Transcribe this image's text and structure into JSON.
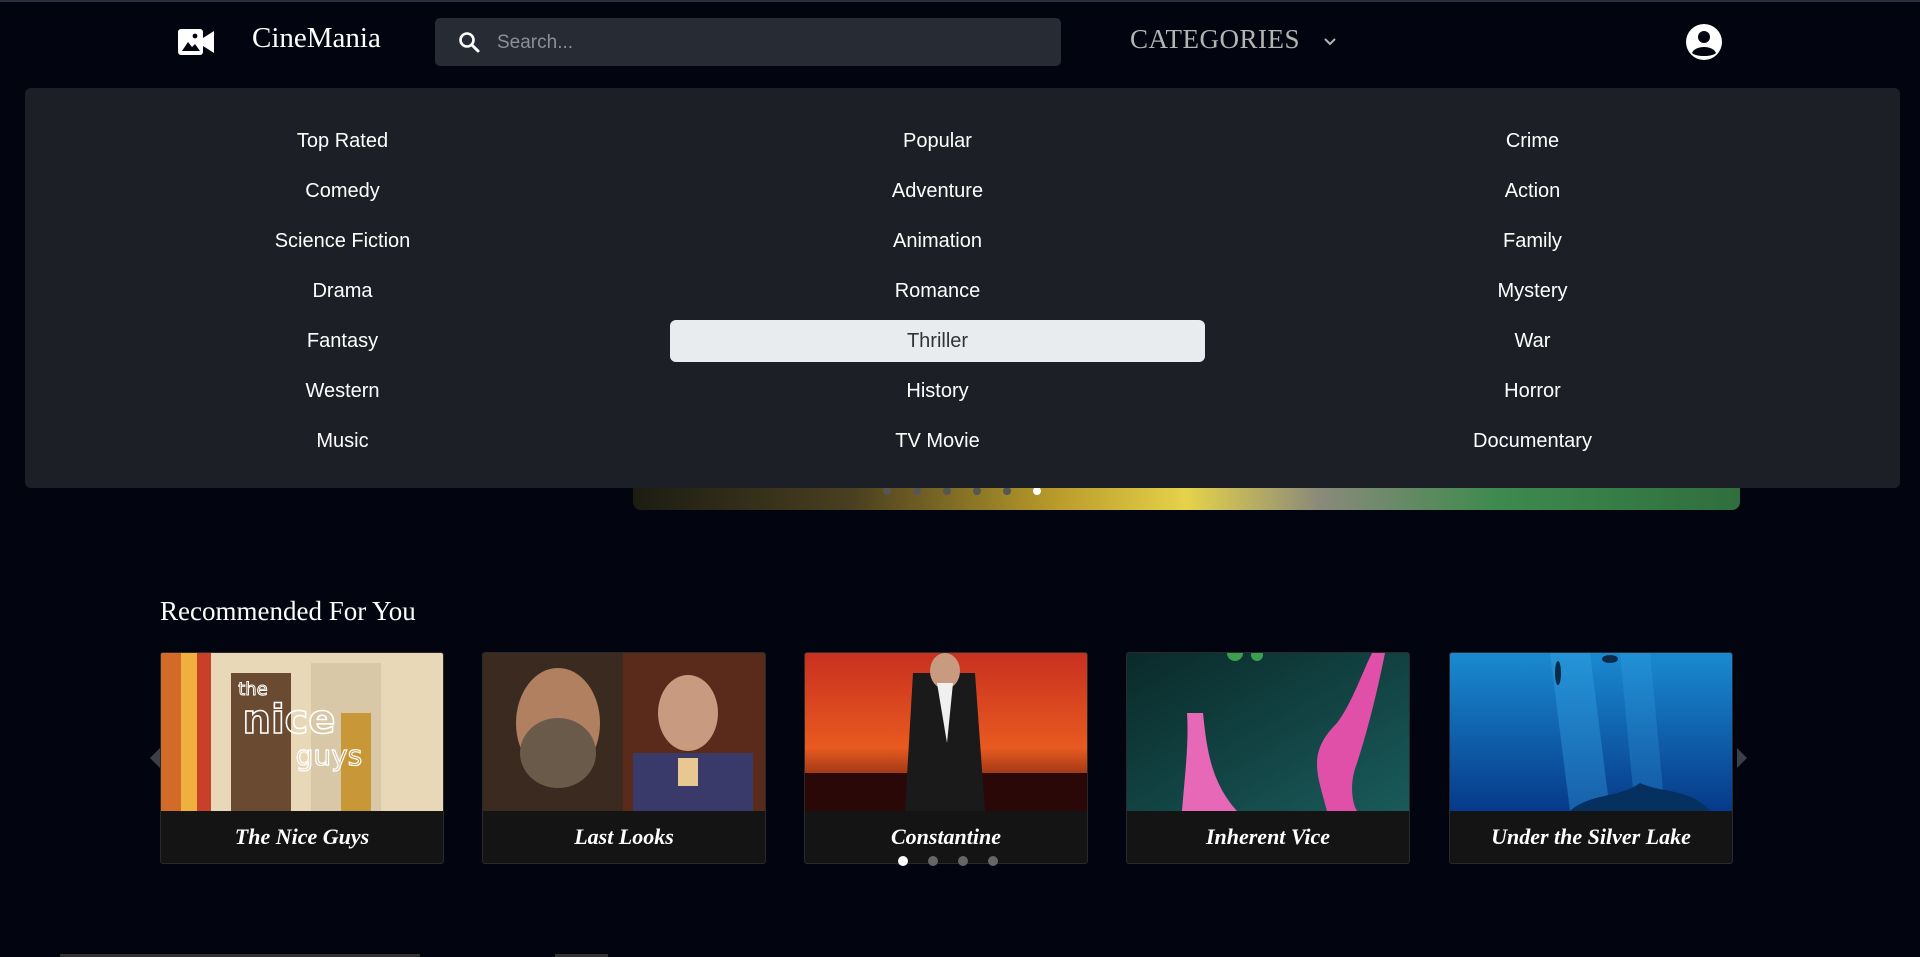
{
  "navbar": {
    "brand": "CineMania",
    "search_placeholder": "Search...",
    "categories_label": "CATEGORIES",
    "logo_icon": "video-camera-icon",
    "account_icon": "account-circle-icon"
  },
  "categories": {
    "columns": [
      [
        "Top Rated",
        "Comedy",
        "Science Fiction",
        "Drama",
        "Fantasy",
        "Western",
        "Music"
      ],
      [
        "Popular",
        "Adventure",
        "Animation",
        "Romance",
        "Thriller",
        "History",
        "TV Movie"
      ],
      [
        "Crime",
        "Action",
        "Family",
        "Mystery",
        "War",
        "Horror",
        "Documentary"
      ]
    ],
    "highlighted": "Thriller"
  },
  "hero": {
    "slide_count": 6,
    "active_slide": 5
  },
  "recommended": {
    "title": "Recommended For You",
    "movies": [
      {
        "title": "The Nice Guys"
      },
      {
        "title": "Last Looks"
      },
      {
        "title": "Constantine"
      },
      {
        "title": "Inherent Vice"
      },
      {
        "title": "Under the Silver Lake"
      }
    ],
    "page_count": 4,
    "active_page": 0
  },
  "colors": {
    "background": "#020510",
    "dropdown_bg": "#1c1f26",
    "search_bg": "#272b33",
    "highlight_bg": "#e9ecef"
  }
}
